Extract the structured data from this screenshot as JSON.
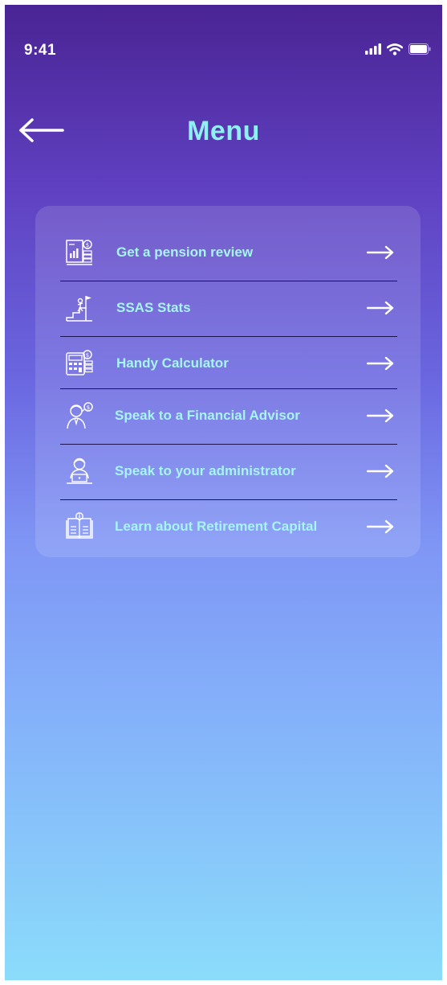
{
  "status_bar": {
    "time": "9:41",
    "icons": [
      "cellular-signal-icon",
      "wifi-icon",
      "battery-icon"
    ]
  },
  "header": {
    "back_icon": "arrow-left-icon",
    "title": "Menu"
  },
  "menu": {
    "items": [
      {
        "label": "Get a pension review",
        "icon": "pension-review-icon",
        "arrow": "arrow-right-icon"
      },
      {
        "label": "SSAS Stats",
        "icon": "stats-icon",
        "arrow": "arrow-right-icon"
      },
      {
        "label": "Handy Calculator",
        "icon": "calculator-icon",
        "arrow": "arrow-right-icon"
      },
      {
        "label": "Speak to a Financial Advisor",
        "icon": "financial-advisor-icon",
        "arrow": "arrow-right-icon"
      },
      {
        "label": "Speak to your administrator",
        "icon": "administrator-icon",
        "arrow": "arrow-right-icon"
      },
      {
        "label": "Learn about Retirement Capital",
        "icon": "learn-book-icon",
        "arrow": "arrow-right-icon"
      }
    ]
  },
  "colors": {
    "title": "#8ff0f2",
    "label": "#a5f5f2",
    "divider": "#1c1450",
    "gradient_top": "#4a2494",
    "gradient_bottom": "#8bdcfb"
  }
}
